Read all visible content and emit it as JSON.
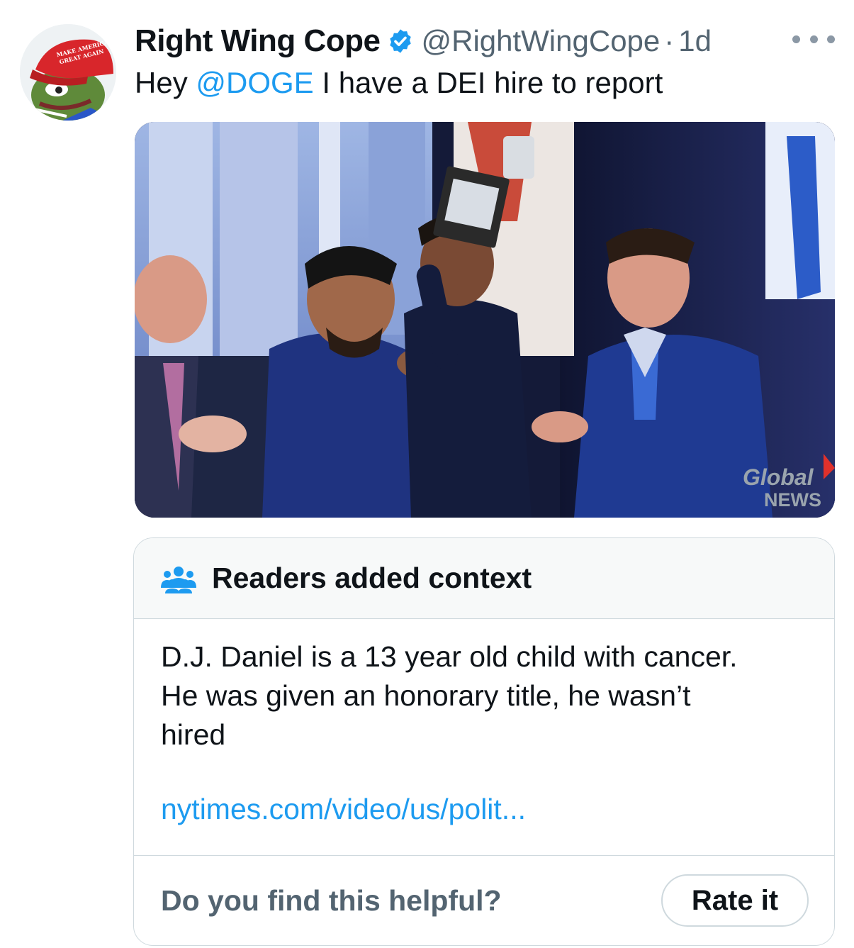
{
  "tweet": {
    "author_name": "Right Wing Cope",
    "handle": "@RightWingCope",
    "separator": "·",
    "time": "1d",
    "text_prefix": "Hey ",
    "mention": "@DOGE",
    "text_suffix": " I have a DEI hire to report",
    "verified_icon": "verified-badge-icon",
    "more_icon": "more-options-icon"
  },
  "avatar": {
    "cap_text_line1": "MAKE AMERICA",
    "cap_text_line2": "GREAT AGAIN"
  },
  "media": {
    "watermark_line1": "Global",
    "watermark_line2": "NEWS"
  },
  "community_note": {
    "icon": "people-icon",
    "title": "Readers added context",
    "body_line1": "D.J. Daniel is a 13 year old child with cancer.",
    "body_line2": "He was given an honorary title, he wasn’t",
    "body_line3": "hired",
    "link": "nytimes.com/video/us/polit...",
    "helpful_question": "Do you find this helpful?",
    "rate_button": "Rate it"
  },
  "colors": {
    "link_blue": "#1d9bf0",
    "secondary_text": "#536471",
    "border": "#cfd9de",
    "note_header_bg": "#f7f9f9"
  }
}
